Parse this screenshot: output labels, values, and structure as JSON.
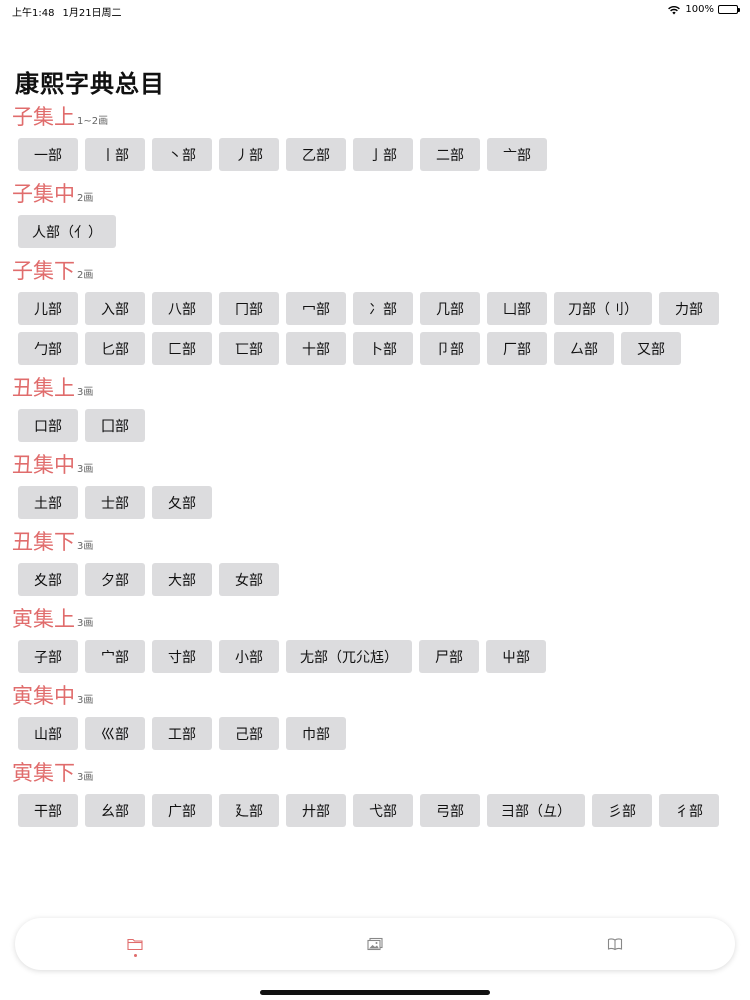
{
  "status": {
    "time": "上午1:48",
    "date": "1月21日周二",
    "battery": "100%"
  },
  "title": "康熙字典总目",
  "sections": [
    {
      "title": "子集上",
      "sub": "1~2画",
      "items": [
        "一部",
        "丨部",
        "丶部",
        "丿部",
        "乙部",
        "亅部",
        "二部",
        "亠部"
      ]
    },
    {
      "title": "子集中",
      "sub": "2画",
      "items": [
        "人部（亻）"
      ]
    },
    {
      "title": "子集下",
      "sub": "2画",
      "items": [
        "儿部",
        "入部",
        "八部",
        "冂部",
        "冖部",
        "冫部",
        "几部",
        "凵部",
        "刀部（刂）",
        "力部",
        "勹部",
        "匕部",
        "匚部",
        "匸部",
        "十部",
        "卜部",
        "卩部",
        "厂部",
        "厶部",
        "又部"
      ]
    },
    {
      "title": "丑集上",
      "sub": "3画",
      "items": [
        "口部",
        "囗部"
      ]
    },
    {
      "title": "丑集中",
      "sub": "3画",
      "items": [
        "土部",
        "士部",
        "夂部"
      ]
    },
    {
      "title": "丑集下",
      "sub": "3画",
      "items": [
        "夊部",
        "夕部",
        "大部",
        "女部"
      ]
    },
    {
      "title": "寅集上",
      "sub": "3画",
      "items": [
        "子部",
        "宀部",
        "寸部",
        "小部",
        "尢部（兀尣尪）",
        "尸部",
        "屮部"
      ]
    },
    {
      "title": "寅集中",
      "sub": "3画",
      "items": [
        "山部",
        "巛部",
        "工部",
        "己部",
        "巾部"
      ]
    },
    {
      "title": "寅集下",
      "sub": "3画",
      "items": [
        "干部",
        "幺部",
        "广部",
        "廴部",
        "廾部",
        "弋部",
        "弓部",
        "彐部（彑）",
        "彡部",
        "彳部"
      ]
    }
  ],
  "tabs": [
    {
      "icon": "folder-icon",
      "active": true
    },
    {
      "icon": "photos-icon",
      "active": false
    },
    {
      "icon": "book-icon",
      "active": false
    }
  ],
  "colors": {
    "accent": "#e06c6c",
    "chip": "#dcdcde"
  }
}
